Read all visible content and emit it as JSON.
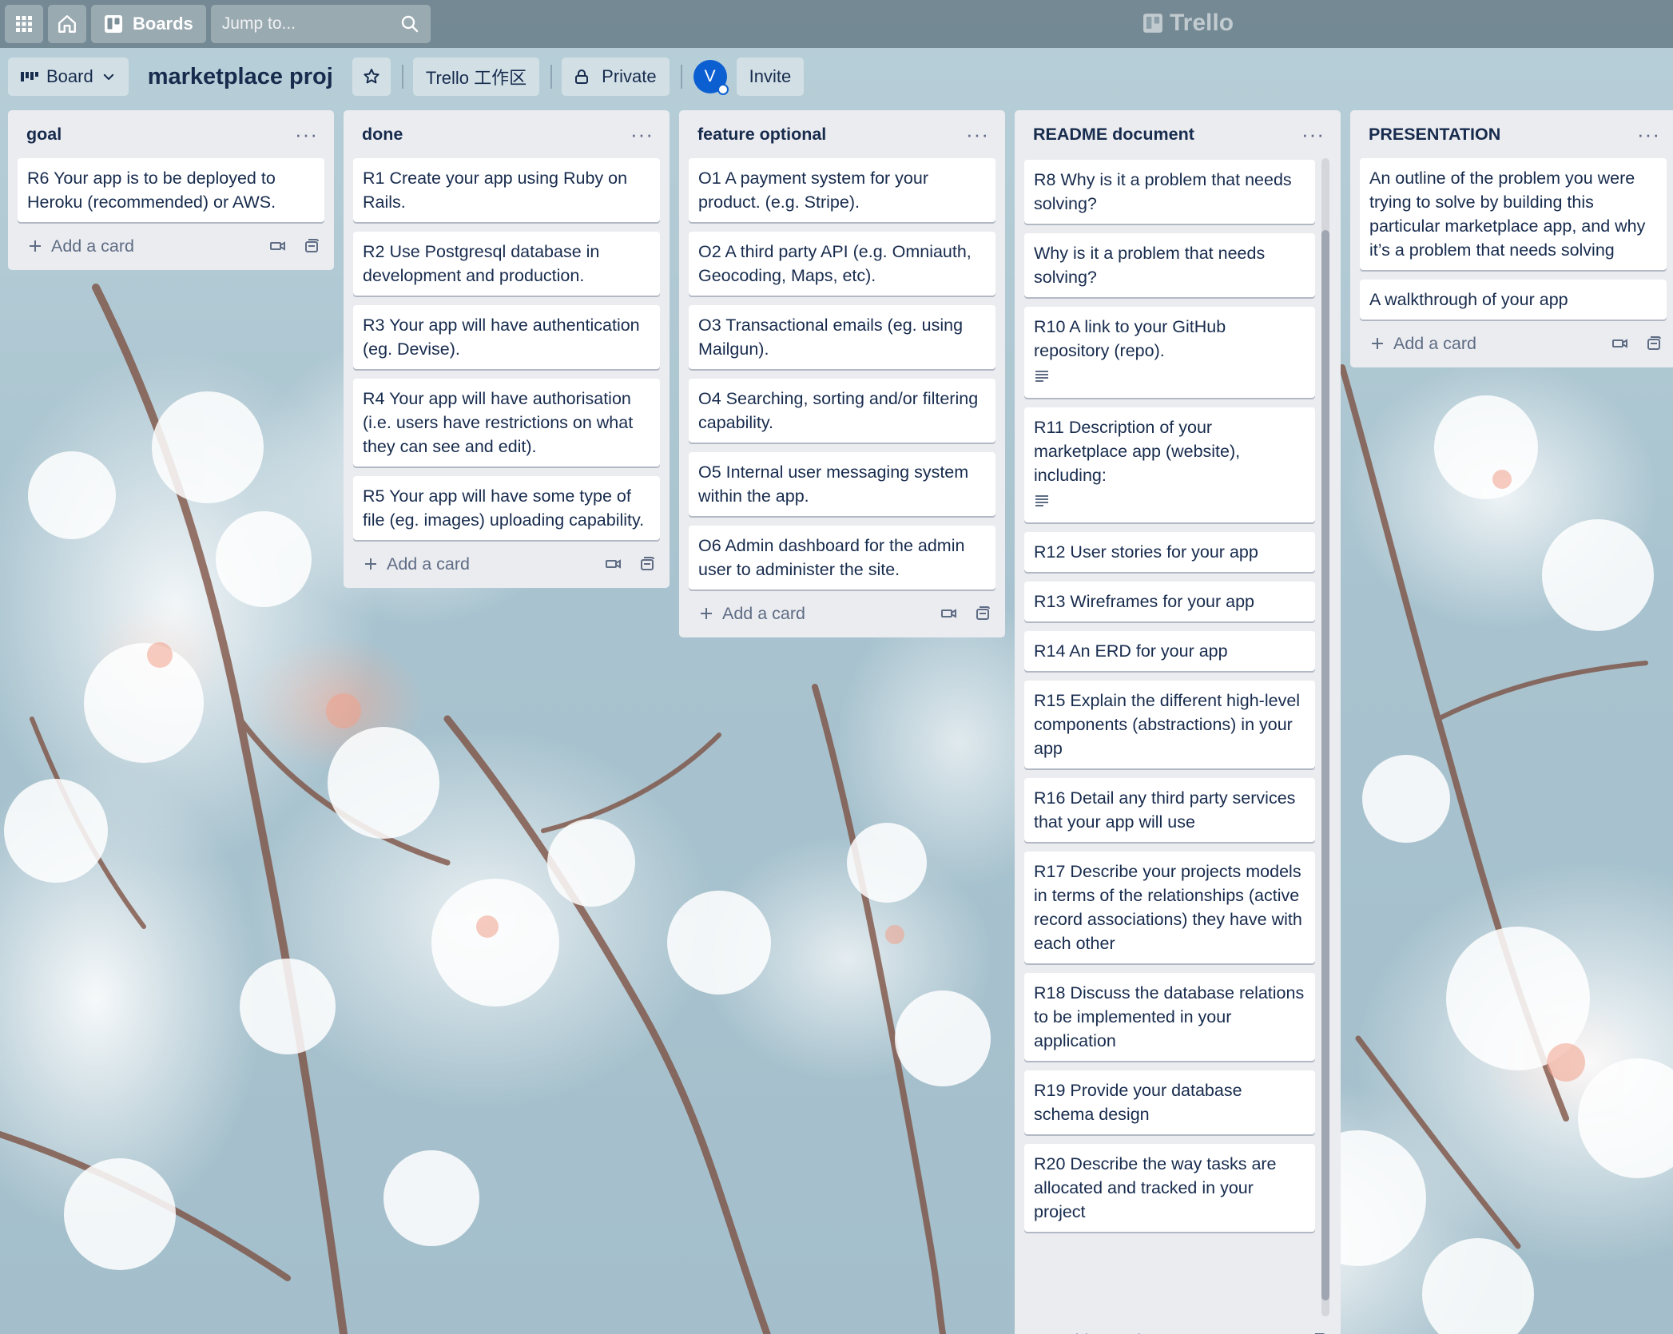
{
  "header": {
    "boards_label": "Boards",
    "search_placeholder": "Jump to...",
    "logo_text": "Trello"
  },
  "board": {
    "view_label": "Board",
    "title": "marketplace proj",
    "workspace_label": "Trello 工作区",
    "visibility_label": "Private",
    "member_initial": "V",
    "invite_label": "Invite"
  },
  "add_card_label": "Add a card",
  "lists": [
    {
      "title": "goal",
      "cards": [
        {
          "text": "R6 Your app is to be deployed to Heroku (recommended) or AWS."
        }
      ]
    },
    {
      "title": "done",
      "cards": [
        {
          "text": "R1 Create your app using Ruby on Rails."
        },
        {
          "text": "R2 Use Postgresql database in development and production."
        },
        {
          "text": "R3 Your app will have authentication (eg. Devise)."
        },
        {
          "text": "R4 Your app will have authorisation (i.e. users have restrictions on what they can see and edit)."
        },
        {
          "text": "R5 Your app will have some type of file (eg. images) uploading capability."
        }
      ]
    },
    {
      "title": "feature optional",
      "cards": [
        {
          "text": "O1 A payment system for your product. (e.g. Stripe)."
        },
        {
          "text": "O2 A third party API (e.g. Omniauth, Geocoding, Maps, etc)."
        },
        {
          "text": "O3 Transactional emails (eg. using Mailgun)."
        },
        {
          "text": "O4 Searching, sorting and/or filtering capability."
        },
        {
          "text": "O5 Internal user messaging system within the app."
        },
        {
          "text": "O6 Admin dashboard for the admin user to administer the site."
        }
      ]
    },
    {
      "title": "README document",
      "cards": [
        {
          "text": "R8 Why is it a problem that needs solving?"
        },
        {
          "text": "Why is it a problem that needs solving?"
        },
        {
          "text": "R10 A link to your GitHub repository (repo).",
          "has_description": true
        },
        {
          "text": "R11 Description of your marketplace app (website), including:",
          "has_description": true
        },
        {
          "text": "R12 User stories for your app"
        },
        {
          "text": "R13 Wireframes for your app"
        },
        {
          "text": "R14 An ERD for your app"
        },
        {
          "text": "R15 Explain the different high-level components (abstractions) in your app"
        },
        {
          "text": "R16 Detail any third party services that your app will use"
        },
        {
          "text": "R17 Describe your projects models in terms of the relationships (active record associations) they have with each other"
        },
        {
          "text": "R18 Discuss the database relations to be implemented in your application"
        },
        {
          "text": "R19 Provide your database schema design"
        },
        {
          "text": "R20 Describe the way tasks are allocated and tracked in your project"
        }
      ]
    },
    {
      "title": "PRESENTATION",
      "cards": [
        {
          "text": "An outline of the problem you were trying to solve by building this particular marketplace app, and why it’s a problem that needs solving"
        },
        {
          "text": "A walkthrough of your app"
        }
      ]
    }
  ]
}
